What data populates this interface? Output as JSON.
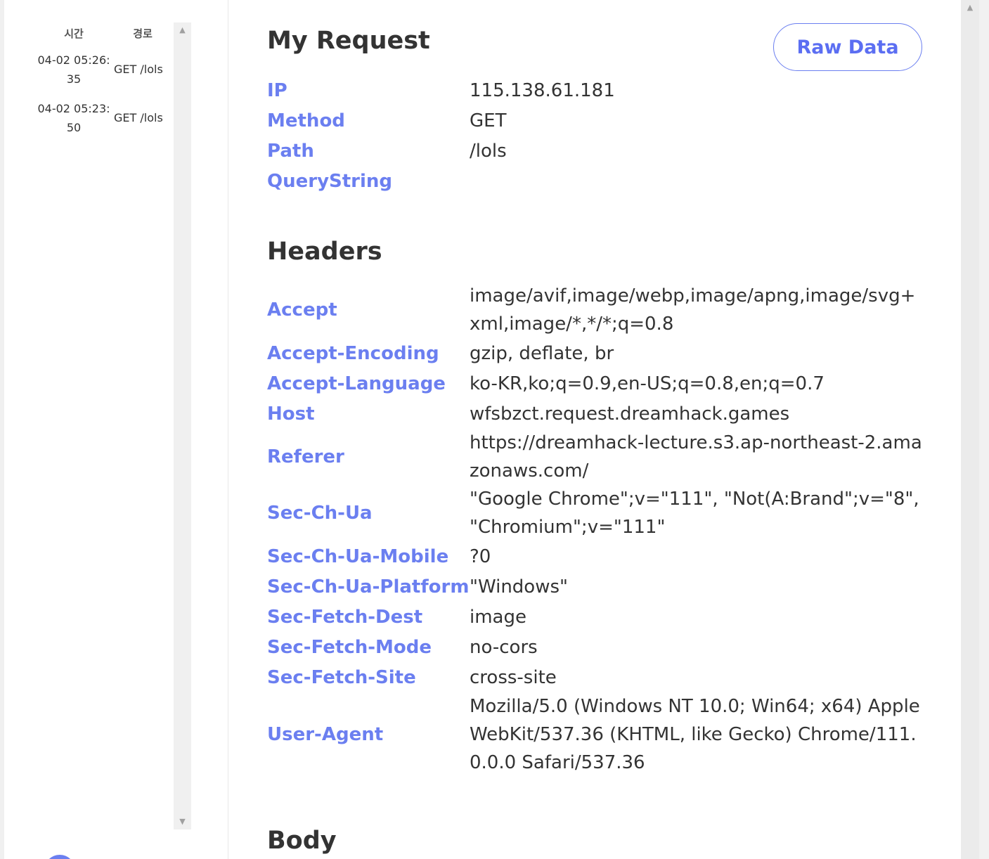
{
  "sidebar": {
    "columns": {
      "time": "시간",
      "path": "경로"
    },
    "logs": [
      {
        "time": "04-02 05:26:35",
        "path": "GET /lols"
      },
      {
        "time": "04-02 05:23:50",
        "path": "GET /lols"
      }
    ],
    "scroll_up_icon": "▲",
    "scroll_down_icon": "▼"
  },
  "request": {
    "title": "My Request",
    "raw_button": "Raw Data",
    "fields": [
      {
        "key": "IP",
        "value": "115.138.61.181"
      },
      {
        "key": "Method",
        "value": "GET"
      },
      {
        "key": "Path",
        "value": "/lols"
      },
      {
        "key": "QueryString",
        "value": ""
      }
    ]
  },
  "headers": {
    "title": "Headers",
    "items": [
      {
        "key": "Accept",
        "value": "image/avif,image/webp,image/apng,image/svg+xml,image/*,*/*;q=0.8"
      },
      {
        "key": "Accept-Encoding",
        "value": "gzip, deflate, br"
      },
      {
        "key": "Accept-Language",
        "value": "ko-KR,ko;q=0.9,en-US;q=0.8,en;q=0.7"
      },
      {
        "key": "Host",
        "value": "wfsbzct.request.dreamhack.games"
      },
      {
        "key": "Referer",
        "value": "https://dreamhack-lecture.s3.ap-northeast-2.amazonaws.com/"
      },
      {
        "key": "Sec-Ch-Ua",
        "value": "\"Google Chrome\";v=\"111\", \"Not(A:Brand\";v=\"8\", \"Chromium\";v=\"111\""
      },
      {
        "key": "Sec-Ch-Ua-Mobile",
        "value": "?0"
      },
      {
        "key": "Sec-Ch-Ua-Platform",
        "value": "\"Windows\""
      },
      {
        "key": "Sec-Fetch-Dest",
        "value": "image"
      },
      {
        "key": "Sec-Fetch-Mode",
        "value": "no-cors"
      },
      {
        "key": "Sec-Fetch-Site",
        "value": "cross-site"
      },
      {
        "key": "User-Agent",
        "value": "Mozilla/5.0 (Windows NT 10.0; Win64; x64) AppleWebKit/537.36 (KHTML, like Gecko) Chrome/111.0.0.0 Safari/537.36"
      }
    ]
  },
  "body": {
    "title": "Body"
  },
  "colors": {
    "accent": "#6b7ff0",
    "text": "#333333"
  }
}
